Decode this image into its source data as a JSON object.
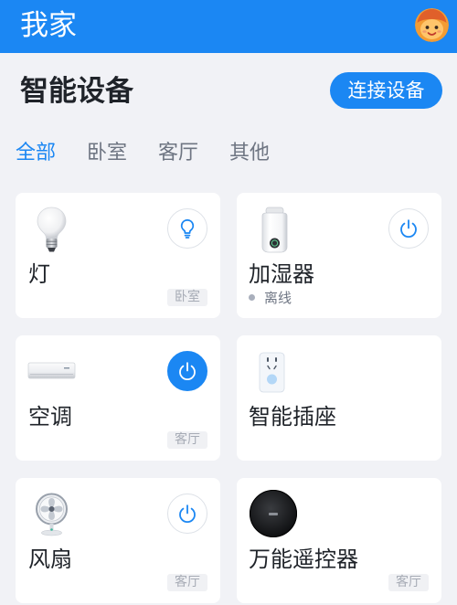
{
  "header": {
    "title": "我家",
    "avatar_icon": "cartoon-avatar-icon"
  },
  "section": {
    "title": "智能设备",
    "connect_button_label": "连接设备"
  },
  "tabs": [
    {
      "label": "全部",
      "active": true
    },
    {
      "label": "卧室",
      "active": false
    },
    {
      "label": "客厅",
      "active": false
    },
    {
      "label": "其他",
      "active": false
    }
  ],
  "devices": [
    {
      "name": "灯",
      "image_icon": "light-bulb-icon",
      "control_icon": "bulb-icon",
      "powered": false,
      "room": "卧室"
    },
    {
      "name": "加湿器",
      "image_icon": "humidifier-icon",
      "control_icon": "power-icon",
      "powered": false,
      "status": "离线"
    },
    {
      "name": "空调",
      "image_icon": "air-conditioner-icon",
      "control_icon": "power-icon",
      "powered": true,
      "room": "客厅"
    },
    {
      "name": "智能插座",
      "image_icon": "smart-plug-icon"
    },
    {
      "name": "风扇",
      "image_icon": "fan-icon",
      "control_icon": "power-icon",
      "powered": false,
      "room": "客厅"
    },
    {
      "name": "万能遥控器",
      "image_icon": "universal-remote-icon",
      "room": "客厅"
    }
  ],
  "colors": {
    "brand": "#1b87f3",
    "background": "#f1f2f6",
    "card": "#ffffff",
    "title_text": "#1f2329",
    "tab_inactive": "#6e7582",
    "tag_background": "#f0f1f4",
    "tag_text": "#a6abb5",
    "offline_dot": "#a9afbc",
    "status_text": "#6f7684"
  }
}
